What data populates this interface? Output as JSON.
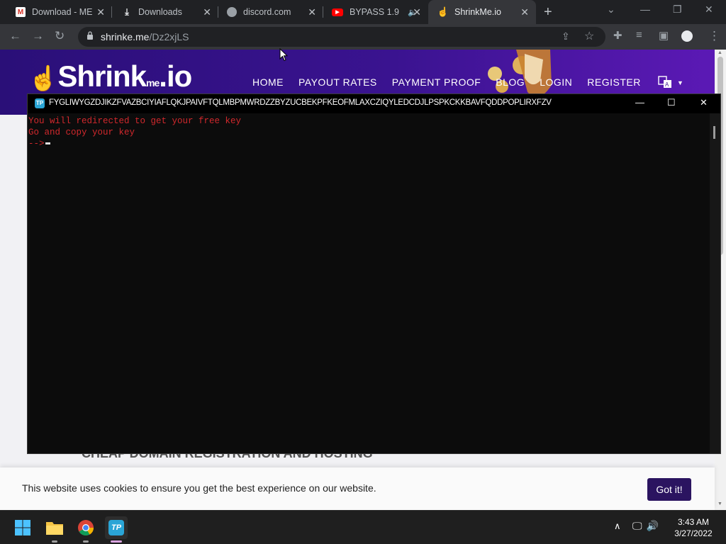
{
  "browser": {
    "tabs": [
      {
        "label": "Download - ME",
        "favicon": "gmail-icon",
        "active": false
      },
      {
        "label": "Downloads",
        "favicon": "download-icon",
        "active": false
      },
      {
        "label": "discord.com",
        "favicon": "globe-icon",
        "active": false
      },
      {
        "label": "BYPASS 1.9",
        "favicon": "youtube-icon",
        "active": false,
        "audio": true
      },
      {
        "label": "ShrinkMe.io",
        "favicon": "shrinkme-icon",
        "active": true
      }
    ],
    "url_host": "shrinke.me",
    "url_path": "/Dz2xjLS"
  },
  "site": {
    "logo_text": "Shrink",
    "logo_suffix": ".io",
    "logo_me": "me",
    "nav": [
      "HOME",
      "PAYOUT RATES",
      "PAYMENT PROOF",
      "BLOG",
      "LOGIN",
      "REGISTER"
    ],
    "background_heading": "CHEAP DOMAIN REGISTRATION AND HOSTING",
    "cookie_text": "This website uses cookies to ensure you get the best experience on our website.",
    "cookie_button": "Got it!"
  },
  "console": {
    "title": "FYGLIWYGZDJIKZFVAZBCIYIAFLQKJPAIVFTQLMBPMWRDZZBYZUCBEKPFKEOFMLAXCZIQYLEDCDJLPSPKCKKBAVFQDDPOPLIRXFZV",
    "lines": [
      "You will redirected to get your free key",
      "Go and copy your key",
      "-->"
    ]
  },
  "taskbar": {
    "time": "3:43 AM",
    "date": "3/27/2022"
  },
  "colors": {
    "console_text": "#d1282c",
    "site_header": "#3a1390",
    "cookie_button": "#2b1460"
  }
}
